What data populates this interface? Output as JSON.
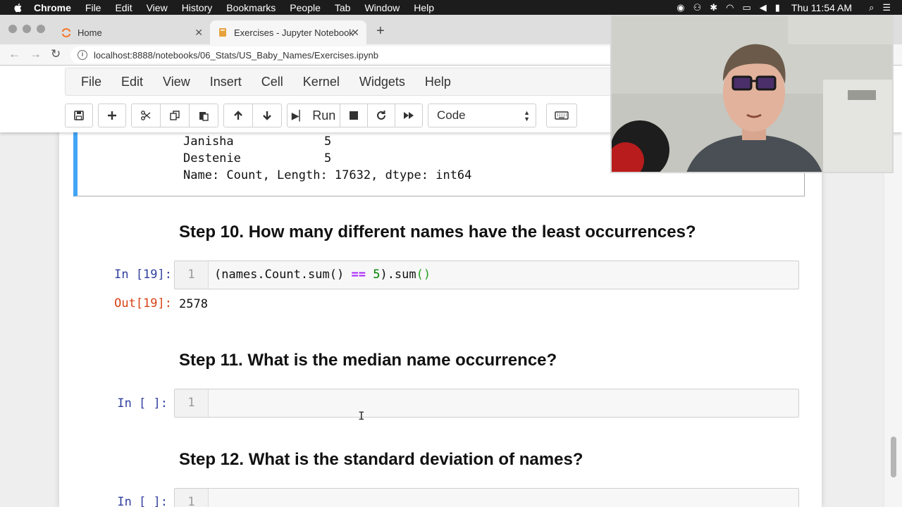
{
  "menubar": {
    "app": "Chrome",
    "items": [
      "File",
      "Edit",
      "View",
      "History",
      "Bookmarks",
      "People",
      "Tab",
      "Window",
      "Help"
    ],
    "clock": "Thu 11:54 AM"
  },
  "browser": {
    "tabs": [
      {
        "label": "Home"
      },
      {
        "label": "Exercises - Jupyter Notebook"
      }
    ],
    "url": "localhost:8888/notebooks/06_Stats/US_Baby_Names/Exercises.ipynb"
  },
  "notebook": {
    "menu": [
      "File",
      "Edit",
      "View",
      "Insert",
      "Cell",
      "Kernel",
      "Widgets",
      "Help"
    ],
    "toolbar": {
      "run_label": "Run",
      "cell_type": "Code"
    },
    "prev_output": [
      {
        "name": "Janisha",
        "count": "5"
      },
      {
        "name": "Destenie",
        "count": "5"
      }
    ],
    "prev_output_footer": "Name: Count, Length: 17632, dtype: int64",
    "step10": {
      "heading": "Step 10. How many different names have the least occurrences?",
      "in_prompt": "In [19]:",
      "line_no": "1",
      "code": {
        "part1": "(names.Count.sum() ",
        "op": "==",
        "part2": " ",
        "num": "5",
        "part3": ").sum",
        "parens": "()"
      },
      "out_prompt": "Out[19]:",
      "output": "2578"
    },
    "step11": {
      "heading": "Step 11. What is the median name occurrence?",
      "in_prompt": "In [ ]:",
      "line_no": "1"
    },
    "step12": {
      "heading": "Step 12. What is the standard deviation of names?",
      "in_prompt": "In [ ]:",
      "line_no": "1"
    }
  },
  "colors": {
    "selected_cell_border": "#42a5f5",
    "in_prompt": "#303f9f",
    "out_prompt": "#d84315"
  }
}
